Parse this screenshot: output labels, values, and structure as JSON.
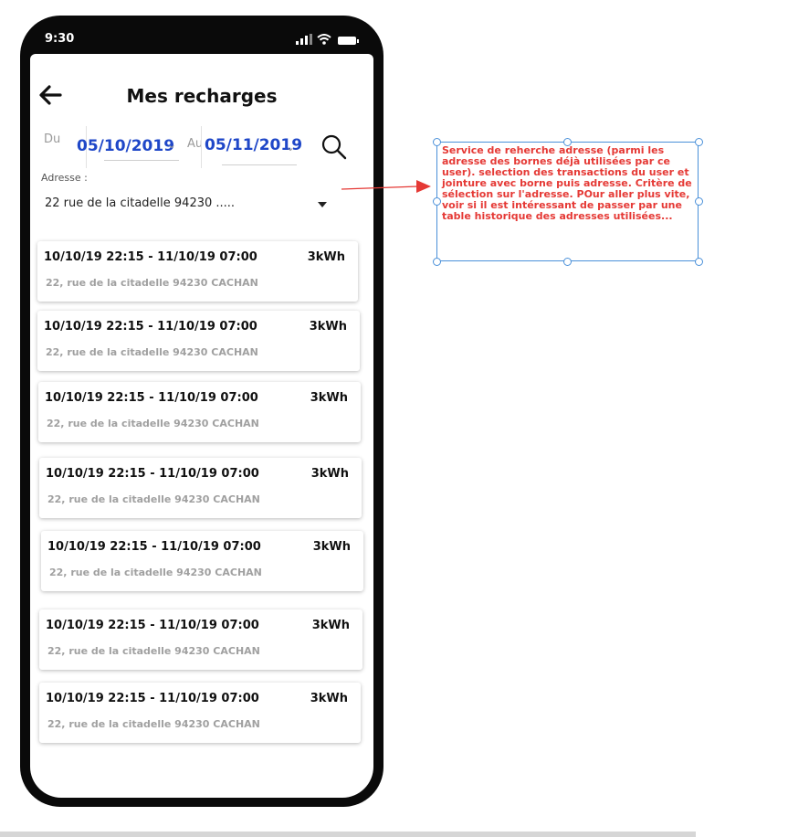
{
  "status": {
    "time": "9:30"
  },
  "header": {
    "title": "Mes recharges"
  },
  "filters": {
    "from_label": "Du",
    "from_date": "05/10/2019",
    "to_label": "Au",
    "to_date": "05/11/2019"
  },
  "address": {
    "label": "Adresse :",
    "value": "22 rue de la citadelle 94230 ....."
  },
  "recharges": [
    {
      "when": "10/10/19 22:15 - 11/10/19 07:00",
      "energy": "3kWh",
      "address": "22, rue de la citadelle 94230 CACHAN"
    },
    {
      "when": "10/10/19 22:15 - 11/10/19 07:00",
      "energy": "3kWh",
      "address": "22, rue de la citadelle 94230 CACHAN"
    },
    {
      "when": "10/10/19 22:15 - 11/10/19 07:00",
      "energy": "3kWh",
      "address": "22, rue de la citadelle 94230 CACHAN"
    },
    {
      "when": "10/10/19 22:15 - 11/10/19 07:00",
      "energy": "3kWh",
      "address": "22, rue de la citadelle 94230 CACHAN"
    },
    {
      "when": "10/10/19 22:15 - 11/10/19 07:00",
      "energy": "3kWh",
      "address": "22, rue de la citadelle 94230 CACHAN"
    },
    {
      "when": "10/10/19 22:15 - 11/10/19 07:00",
      "energy": "3kWh",
      "address": "22, rue de la citadelle 94230 CACHAN"
    },
    {
      "when": "10/10/19 22:15 - 11/10/19 07:00",
      "energy": "3kWh",
      "address": "22, rue de la citadelle 94230 CACHAN"
    }
  ],
  "annotation": {
    "text": "Service de reherche adresse (parmi les adresse des bornes déjà utilisées par ce user).  selection des transactions du user et jointure avec borne puis adresse. Critère de sélection sur l'adresse. POur aller plus vite, voir si il est intéressant de passer par une table historique des adresses utilisées..."
  },
  "colors": {
    "accent": "#1f47c8",
    "annotation_text": "#e53935",
    "annotation_border": "#4a90d9"
  },
  "icons": {
    "back": "arrow-left-icon",
    "search": "search-icon",
    "dropdown": "caret-down-icon",
    "chevron": "chevron-down-icon"
  }
}
